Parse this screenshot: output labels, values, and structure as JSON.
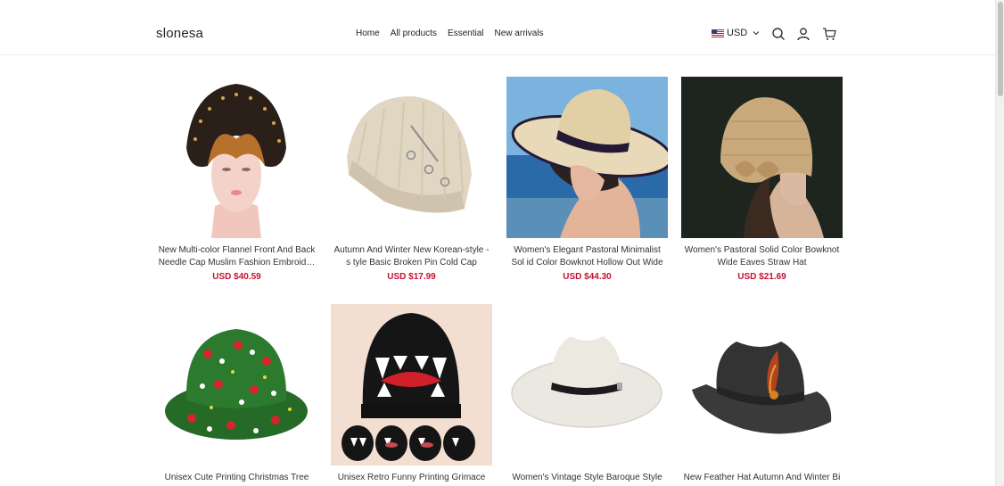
{
  "header": {
    "logo": "slonesa",
    "nav": [
      "Home",
      "All products",
      "Essential",
      "New arrivals"
    ],
    "currency": "USD",
    "icons": [
      "search-icon",
      "account-icon",
      "cart-icon"
    ]
  },
  "products": [
    {
      "title": "New Multi-color Flannel Front And Back Needle Cap Muslim Fashion Embroid…",
      "price": "USD $40.59"
    },
    {
      "title": "Autumn And Winter New Korean-style -s tyle Basic Broken Pin Cold Cap Knitte…",
      "price": "USD $17.99"
    },
    {
      "title": "Women's Elegant Pastoral Minimalist Sol id Color Bowknot Hollow Out Wide Ea…",
      "price": "USD $44.30"
    },
    {
      "title": "Women's Pastoral Solid Color Bowknot Wide Eaves Straw Hat",
      "price": "USD $21.69"
    },
    {
      "title": "Unisex Cute Printing Christmas Tree Sno",
      "price": ""
    },
    {
      "title": "Unisex Retro Funny Printing Grimace Ea",
      "price": ""
    },
    {
      "title": "Women's Vintage Style Baroque Style Et",
      "price": ""
    },
    {
      "title": "New Feather Hat Autumn And Winter Bi",
      "price": ""
    }
  ],
  "colors": {
    "price": "#c8102e",
    "border": "#ececec"
  }
}
